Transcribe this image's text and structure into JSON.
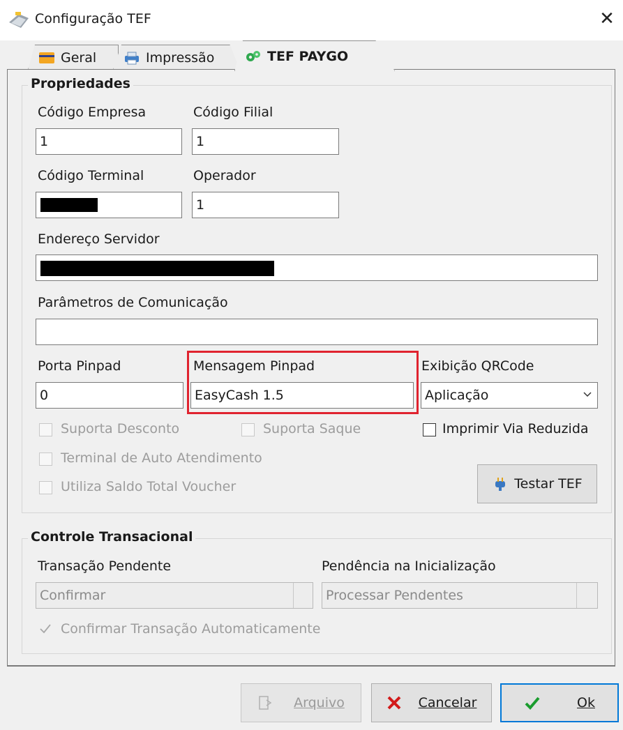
{
  "window": {
    "title": "Configuração TEF",
    "close_symbol": "✕"
  },
  "tabs": [
    {
      "label": "Geral",
      "icon": "card-icon"
    },
    {
      "label": "Impressão",
      "icon": "printer-icon"
    },
    {
      "label": "TEF PAYGO",
      "icon": "gears-icon",
      "active": true
    }
  ],
  "propriedades": {
    "title": "Propriedades",
    "codigo_empresa": {
      "label": "Código Empresa",
      "value": "1"
    },
    "codigo_filial": {
      "label": "Código Filial",
      "value": "1"
    },
    "codigo_terminal": {
      "label": "Código Terminal",
      "value": "[redacted]"
    },
    "operador": {
      "label": "Operador",
      "value": "1"
    },
    "endereco_servidor": {
      "label": "Endereço Servidor",
      "value": "[redacted]"
    },
    "parametros_comunicacao": {
      "label": "Parâmetros de Comunicação",
      "value": ""
    },
    "porta_pinpad": {
      "label": "Porta Pinpad",
      "value": "0"
    },
    "mensagem_pinpad": {
      "label": "Mensagem Pinpad",
      "value": "EasyCash 1.5"
    },
    "exibicao_qrcode": {
      "label": "Exibição QRCode",
      "value": "Aplicação"
    },
    "suporta_desconto": {
      "label": "Suporta Desconto",
      "checked": false,
      "enabled": false
    },
    "suporta_saque": {
      "label": "Suporta Saque",
      "checked": false,
      "enabled": false
    },
    "imprimir_via_reduzida": {
      "label": "Imprimir Via Reduzida",
      "checked": false,
      "enabled": true
    },
    "terminal_auto_atendimento": {
      "label": "Terminal de Auto Atendimento",
      "checked": false,
      "enabled": false
    },
    "utiliza_saldo_voucher": {
      "label": "Utiliza Saldo Total Voucher",
      "checked": false,
      "enabled": false
    },
    "testar_tef": {
      "label": "Testar TEF"
    }
  },
  "controle": {
    "title": "Controle Transacional",
    "transacao_pendente": {
      "label": "Transação Pendente",
      "value": "Confirmar"
    },
    "pendencia_inicializacao": {
      "label": "Pendência na Inicialização",
      "value": "Processar Pendentes"
    },
    "confirmar_automaticamente": {
      "label": "Confirmar Transação Automaticamente",
      "checked": true,
      "enabled": false
    }
  },
  "buttons": {
    "arquivo": {
      "label": "Arquivo",
      "enabled": false
    },
    "cancelar": {
      "label": "Cancelar"
    },
    "ok": {
      "label": "Ok"
    }
  },
  "colors": {
    "highlight": "#e0232f",
    "accent": "#0078d7"
  }
}
